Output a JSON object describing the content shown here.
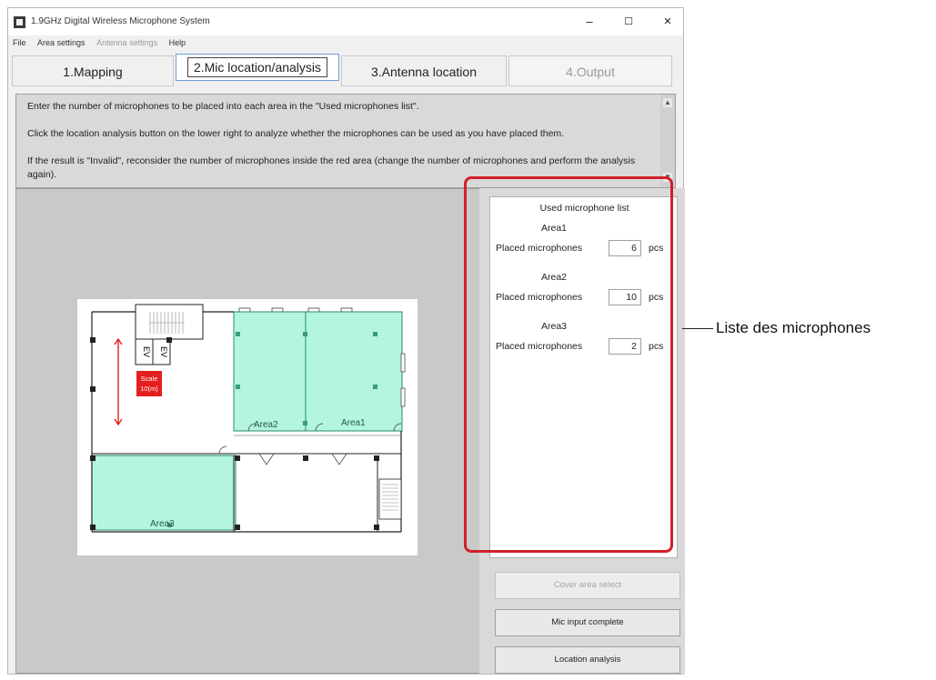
{
  "window": {
    "title": "1.9GHz Digital Wireless Microphone System",
    "minimize": "–",
    "maximize": "☐",
    "close": "✕"
  },
  "menu": {
    "file": "File",
    "area_settings": "Area settings",
    "antenna_settings": "Antenna settings",
    "help": "Help"
  },
  "tabs": [
    {
      "label": "1.Mapping"
    },
    {
      "label": "2.Mic location/analysis"
    },
    {
      "label": "3.Antenna location"
    },
    {
      "label": "4.Output"
    }
  ],
  "instructions": {
    "line1": "Enter the number of microphones to be placed into each area in the \"Used microphones list\".",
    "line2": "Click the location analysis button on the lower right to analyze whether the microphones can be used as you have placed them.",
    "line3": "If the result is \"Invalid\", reconsider the number of microphones inside the red area (change the number of microphones and perform the analysis again)."
  },
  "floorplan": {
    "ev1": "EV",
    "ev2": "EV",
    "scale_line1": "Scale",
    "scale_line2": "10(m)",
    "area1": "Area1",
    "area2": "Area2",
    "area3": "Area3",
    "colors": {
      "area_fill": "#b3f5df",
      "scale_red": "#e41e1e"
    }
  },
  "mic_list": {
    "header": "Used microphone list",
    "areas": [
      {
        "name": "Area1",
        "label": "Placed microphones",
        "count": "6",
        "unit": "pcs"
      },
      {
        "name": "Area2",
        "label": "Placed microphones",
        "count": "10",
        "unit": "pcs"
      },
      {
        "name": "Area3",
        "label": "Placed microphones",
        "count": "2",
        "unit": "pcs"
      }
    ]
  },
  "buttons": {
    "cover_area_select": "Cover area select",
    "mic_input_complete": "Mic input complete",
    "location_analysis": "Location analysis"
  },
  "callout": {
    "text": "Liste des microphones",
    "color": "#d2202a"
  }
}
